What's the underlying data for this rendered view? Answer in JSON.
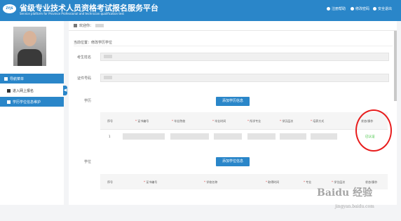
{
  "header": {
    "logo_text": "ZYJS",
    "title": "省级专业技术人员资格考试报名服务平台",
    "subtitle": "Service platform for Province Professional and technician qualification test",
    "links": [
      {
        "icon": "info-circle-icon",
        "label": "注册帮助"
      },
      {
        "icon": "lock-icon",
        "label": "修改密码"
      },
      {
        "icon": "power-icon",
        "label": "安全退出"
      }
    ]
  },
  "sidebar": {
    "nav_heading": "导航菜单",
    "items": [
      {
        "label": "进入网上报名",
        "icon": "enter-icon",
        "active": false
      },
      {
        "label": "学历学位信息维护",
        "icon": "book-icon",
        "active": true
      }
    ],
    "collapse_arrow": "◀"
  },
  "main": {
    "breadcrumb_label": "欢迎你：",
    "location": "当前位置：修改学历学位",
    "form": {
      "name_label": "考生姓名",
      "id_label": "证件号码",
      "education_label": "学历",
      "degree_label": "学位"
    },
    "education": {
      "add_button": "添加学历信息",
      "columns": [
        {
          "label": "序号",
          "required": false
        },
        {
          "label": "证书编号",
          "required": true
        },
        {
          "label": "毕业院校",
          "required": true
        },
        {
          "label": "毕业时间",
          "required": true
        },
        {
          "label": "所学专业",
          "required": true
        },
        {
          "label": "学历层次",
          "required": true
        },
        {
          "label": "培养方式",
          "required": true
        },
        {
          "label": "状态/操作",
          "required": false
        }
      ],
      "rows": [
        {
          "index": "1",
          "status": "已认证"
        }
      ]
    },
    "degree": {
      "add_button": "添加学位信息",
      "columns": [
        {
          "label": "序号",
          "required": false
        },
        {
          "label": "证书编号",
          "required": true
        },
        {
          "label": "学校名称",
          "required": true
        },
        {
          "label": "取得时间",
          "required": true
        },
        {
          "label": "专业",
          "required": true
        },
        {
          "label": "学位层次",
          "required": true
        },
        {
          "label": "状态/操作",
          "required": false
        }
      ]
    }
  },
  "annotation": {
    "color": "#e81d1d"
  },
  "watermark": {
    "brand": "Baidu 经验",
    "url": "jingyan.baidu.com"
  },
  "colors": {
    "primary": "#2a86c9",
    "status_green": "#2fbf2f"
  }
}
